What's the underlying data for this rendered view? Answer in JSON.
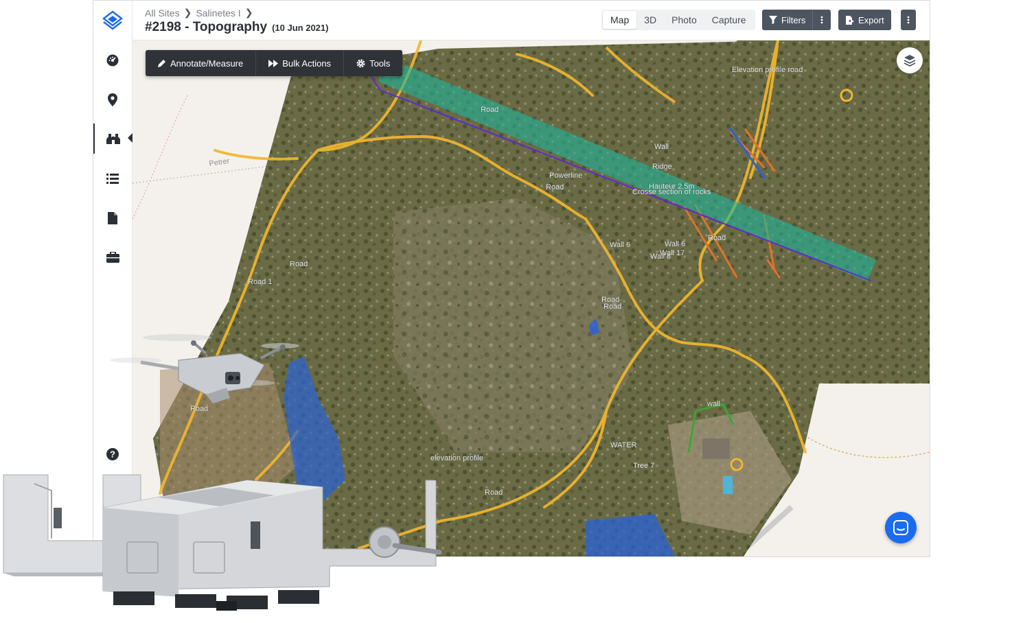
{
  "header": {
    "breadcrumbs": [
      "All Sites",
      "Salinetes I"
    ],
    "title": "#2198 - Topography",
    "date": "(10 Jun 2021)",
    "view_tabs": [
      {
        "label": "Map",
        "active": true
      },
      {
        "label": "3D",
        "active": false
      },
      {
        "label": "Photo",
        "active": false
      },
      {
        "label": "Capture",
        "active": false
      }
    ],
    "filters_label": "Filters",
    "export_label": "Export"
  },
  "sidebar": {
    "items": [
      {
        "icon": "dashboard-icon"
      },
      {
        "icon": "map-pin-icon"
      },
      {
        "icon": "binoculars-icon",
        "active": true
      },
      {
        "icon": "list-icon"
      },
      {
        "icon": "document-icon"
      },
      {
        "icon": "briefcase-icon"
      }
    ],
    "help_icon": "help-icon"
  },
  "toolbar": {
    "annotate_label": "Annotate/Measure",
    "bulk_label": "Bulk Actions",
    "tools_label": "Tools"
  },
  "map": {
    "labels": {
      "elevation_profile_road": "Elevation profile road",
      "road_top": "Road",
      "wall_1": "Wall",
      "ridge": "Ridge",
      "powerline": "Powerline",
      "road_mid": "Road",
      "hauteur": "Hauteur 2.5m",
      "cross_section": "Crosse section of rocks",
      "road_right": "Road",
      "wall_6": "Wall 6",
      "wall_6b": "Wall 6",
      "wall_17": "Wall 17",
      "wall_8": "Wall 8",
      "road_left": "Road",
      "road_1": "Road 1",
      "road_center_1": "Road",
      "road_center_2": "Road",
      "wall_lower": "wall",
      "water": "WATER",
      "tree_7": "Tree 7",
      "elevation_profile": "elevation profile",
      "road_bottom": "Road",
      "road_sw": "Road",
      "petrer": "Petrer"
    }
  },
  "colors": {
    "accent": "#1a6bf0",
    "road": "#f2b62e",
    "powerline_band": "#1fb59a",
    "powerline_line": "#5b2bd6",
    "wall": "#e0722a",
    "water": "#2a62d8"
  }
}
